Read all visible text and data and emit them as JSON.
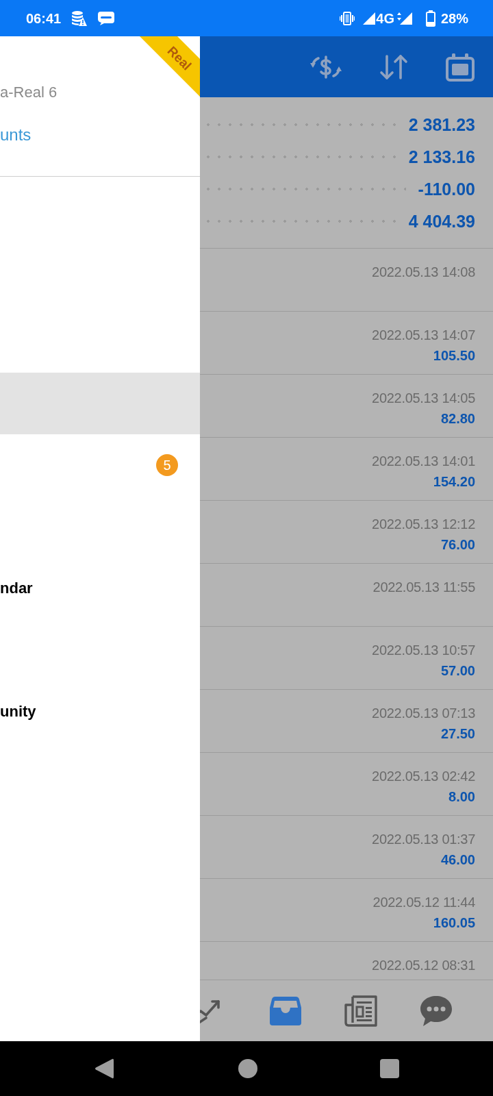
{
  "status_bar": {
    "time": "06:41",
    "network": "4G",
    "battery": "28%"
  },
  "drawer": {
    "account": "a-Real 6",
    "accounts_link": "unts",
    "ribbon": "Real",
    "menu": [
      {
        "selected": false
      },
      {
        "selected": false
      },
      {
        "selected": false
      },
      {
        "selected": true
      },
      {
        "selected": false,
        "badge": "5"
      },
      {
        "selected": false
      },
      {
        "selected": false,
        "label": "ndar"
      },
      {
        "selected": false
      },
      {
        "selected": false,
        "label": "unity"
      }
    ]
  },
  "summary": [
    "2 381.23",
    "2 133.16",
    "-110.00",
    "4 404.39"
  ],
  "history": [
    {
      "time": "2022.05.13 14:08"
    },
    {
      "time": "2022.05.13 14:07",
      "amount": "105.50"
    },
    {
      "time": "2022.05.13 14:05",
      "amount": "82.80"
    },
    {
      "time": "2022.05.13 14:01",
      "amount": "154.20"
    },
    {
      "time": "2022.05.13 12:12",
      "amount": "76.00"
    },
    {
      "time": "2022.05.13 11:55"
    },
    {
      "time": "2022.05.13 10:57",
      "amount": "57.00"
    },
    {
      "time": "2022.05.13 07:13",
      "amount": "27.50"
    },
    {
      "time": "2022.05.13 02:42",
      "amount": "8.00"
    },
    {
      "time": "2022.05.13 01:37",
      "amount": "46.00"
    },
    {
      "time": "2022.05.12 11:44",
      "amount": "160.05"
    },
    {
      "time": "2022.05.12 08:31"
    }
  ],
  "bottom_nav": [
    {
      "kind": "trend",
      "selected": false
    },
    {
      "kind": "inbox",
      "selected": true
    },
    {
      "kind": "news",
      "selected": false
    },
    {
      "kind": "chat",
      "selected": false
    }
  ]
}
